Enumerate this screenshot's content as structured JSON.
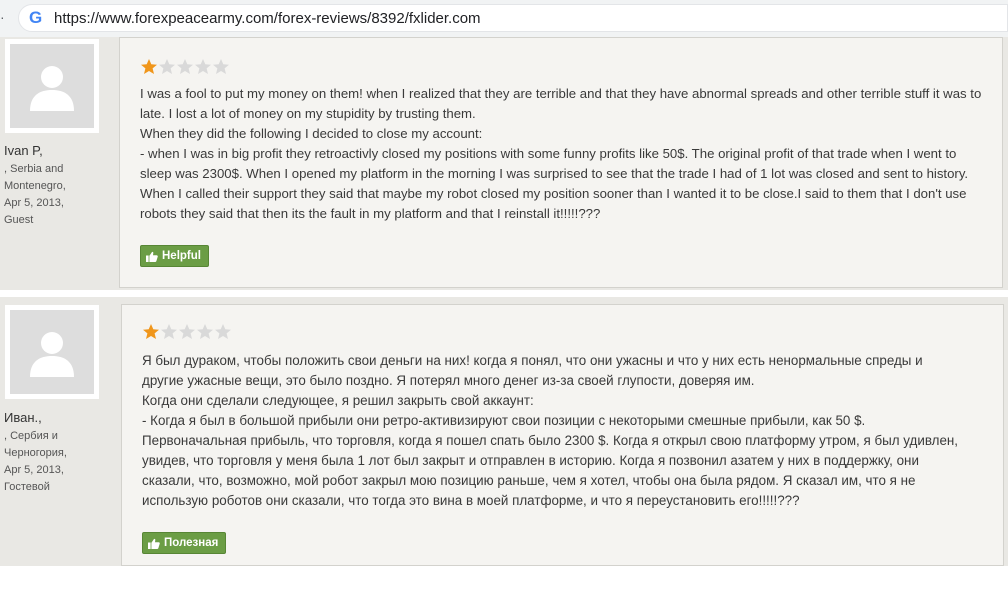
{
  "browser": {
    "url": "https://www.forexpeacearmy.com/forex-reviews/8392/fxlider.com",
    "google_icon": "G"
  },
  "reviews": [
    {
      "user_name": "Ivan P,",
      "location_line1": ", Serbia and",
      "location_line2": "Montenegro,",
      "date": "Apr 5, 2013,",
      "role": "Guest",
      "rating": 1,
      "rating_max": 5,
      "paragraphs": [
        "I was a fool to put my money on them! when I realized that they are terrible and that they have abnormal spreads and other terrible stuff it was to late. I lost a lot of money on my stupidity by trusting them.",
        "When they did the following I decided to close my account:",
        "- when I was in big profit they retroactivly closed my positions with some funny profits like 50$. The original profit of that trade when I went to sleep was 2300$. When I opened my platform in the morning I was surprised to see that the trade I had of 1 lot was closed and sent to history. When I called their support they said that maybe my robot closed my position sooner than I wanted it to be close.I said to them that I don't use robots they said that then its the fault in my platform and that I reinstall it!!!!!???"
      ],
      "helpful_label": "Helpful"
    },
    {
      "user_name": "Иван.,",
      "location_line1": ", Сербия и",
      "location_line2": "Черногория,",
      "date": "Apr 5, 2013,",
      "role": "Гостевой",
      "rating": 1,
      "rating_max": 5,
      "paragraphs": [
        "Я был дураком, чтобы положить свои деньги на них! когда я понял, что они ужасны и что у них есть ненормальные спреды и другие ужасные вещи, это было поздно. Я потерял много денег из-за своей глупости, доверяя им.",
        "Когда они сделали следующее, я решил закрыть свой аккаунт:",
        "- Когда я был в большой прибыли они ретро-активизируют свои позиции с некоторыми смешные прибыли, как 50 $. Первоначальная прибыль, что торговля, когда я пошел спать было 2300 $. Когда я открыл свою платформу утром, я был удивлен, увидев, что торговля у меня была 1 лот был закрыт и отправлен в историю. Когда я позвонил азатем у них в поддержку, они сказали, что, возможно, мой робот закрыл мою позицию раньше, чем я хотел, чтобы она была рядом. Я сказал им, что я не использую роботов они сказали, что тогда это вина в моей платформе, и что я переустановить его!!!!!???"
      ],
      "helpful_label": "Полезная"
    }
  ],
  "colors": {
    "star_filled": "#f0961b",
    "star_empty": "#d9d9d9",
    "helpful_button": "#6b9d45"
  },
  "icons": {
    "avatar": "default-avatar-icon",
    "star": "star-icon",
    "thumbs_up": "thumbs-up-icon"
  }
}
